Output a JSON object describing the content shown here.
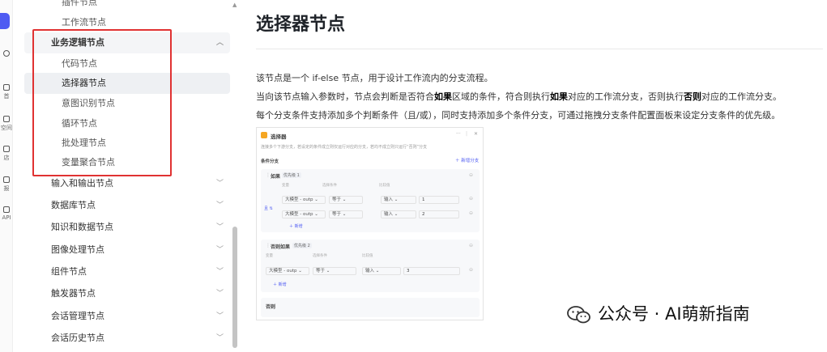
{
  "rail": {
    "items": [
      {
        "label": "",
        "icon": "clock-icon"
      },
      {
        "label": "首",
        "icon": "home-icon"
      },
      {
        "label": "空间",
        "icon": "workspace-icon"
      },
      {
        "label": "店",
        "icon": "store-icon"
      },
      {
        "label": "报",
        "icon": "report-icon"
      },
      {
        "label": "API",
        "icon": "api-icon"
      }
    ]
  },
  "sidebar": {
    "items": [
      {
        "label": "插件节点"
      },
      {
        "label": "工作流节点"
      },
      {
        "label": "业务逻辑节点"
      },
      {
        "label": "代码节点"
      },
      {
        "label": "选择器节点"
      },
      {
        "label": "意图识别节点"
      },
      {
        "label": "循环节点"
      },
      {
        "label": "批处理节点"
      },
      {
        "label": "变量聚合节点"
      },
      {
        "label": "输入和输出节点"
      },
      {
        "label": "数据库节点"
      },
      {
        "label": "知识和数据节点"
      },
      {
        "label": "图像处理节点"
      },
      {
        "label": "组件节点"
      },
      {
        "label": "触发器节点"
      },
      {
        "label": "会话管理节点"
      },
      {
        "label": "会话历史节点"
      }
    ]
  },
  "article": {
    "title": "选择器节点",
    "p1": "该节点是一个 if-else 节点，用于设计工作流内的分支流程。",
    "p2": {
      "a": "当向该节点输入参数时，节点会判断是否符合",
      "b": "如果",
      "c": "区域的条件，符合则执行",
      "d": "如果",
      "e": "对应的工作流分支，否则执行",
      "f": "否则",
      "g": "对应的工作流分支。"
    },
    "p3": "每个分支条件支持添加多个判断条件（且/或），同时支持添加多个条件分支，可通过拖拽分支条件配置面板来设定分支条件的优先级。"
  },
  "screenshot": {
    "node_title": "选择器",
    "description": "连接多个下游分支，若设定的条件成立则仅运行对应的分支，若均不成立则只运行“否则”分支",
    "section_label": "条件分支",
    "add_branch": "新增分支",
    "if_label": "如果",
    "if_priority": "优先级 1",
    "else_if_label": "否则如果",
    "else_if_priority": "优先级 2",
    "else_label": "否则",
    "logic_label": "且",
    "add_label": "新增",
    "col_var": "变量",
    "col_cond": "选择条件",
    "col_val": "比较值",
    "var_value": "大模型 - outp",
    "cond_equal": "等于",
    "input_type": "输入",
    "value_1": "1",
    "value_2": "2",
    "value_3": "3"
  },
  "watermark": {
    "text": "公众号 · AI萌新指南",
    "icon": "wechat-icon"
  },
  "colors": {
    "accent": "#4e5bf2",
    "highlight_border": "#e03232"
  }
}
